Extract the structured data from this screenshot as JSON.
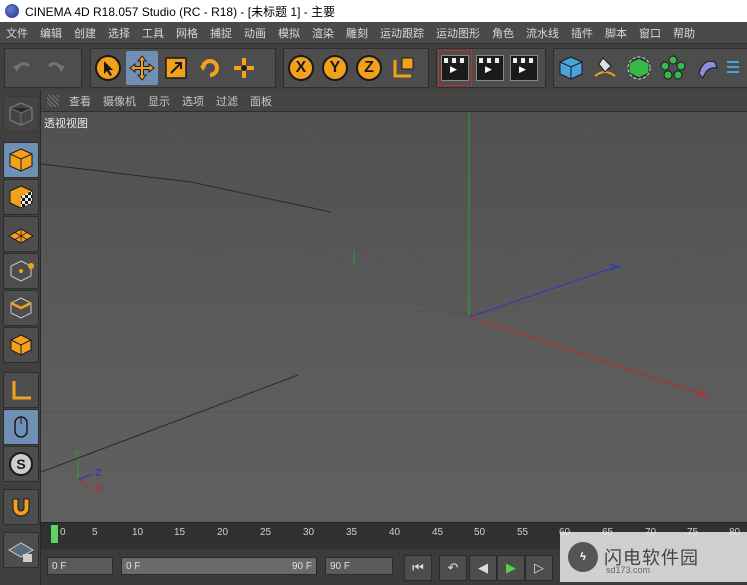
{
  "window": {
    "title": "CINEMA 4D R18.057 Studio (RC - R18) - [未标题 1] - 主要"
  },
  "menubar": {
    "items": [
      "文件",
      "编辑",
      "创建",
      "选择",
      "工具",
      "网格",
      "捕捉",
      "动画",
      "模拟",
      "渲染",
      "雕刻",
      "运动跟踪",
      "运动图形",
      "角色",
      "流水线",
      "插件",
      "脚本",
      "窗口",
      "帮助"
    ]
  },
  "toolbar": {
    "undo_icon": "undo-icon",
    "redo_icon": "redo-icon",
    "axis_x": "X",
    "axis_y": "Y",
    "axis_z": "Z"
  },
  "viewport_menu": {
    "items": [
      "查看",
      "摄像机",
      "显示",
      "选项",
      "过滤",
      "面板"
    ]
  },
  "viewport": {
    "label": "透视视图"
  },
  "axis_indicator": {
    "y": "Y",
    "z": "Z",
    "x": "X"
  },
  "timeline": {
    "ticks": [
      "0",
      "5",
      "10",
      "15",
      "20",
      "25",
      "30",
      "35",
      "40",
      "45",
      "50",
      "55",
      "60",
      "65",
      "70",
      "75",
      "80"
    ]
  },
  "bottom": {
    "current_frame": "0 F",
    "range_start": "0 F",
    "range_end": "90 F",
    "max_frame": "90 F"
  },
  "watermark": {
    "text": "闪电软件园",
    "sub": "sd173.com"
  },
  "colors": {
    "accent_orange": "#f3a11d",
    "active_blue": "#6f8fb5",
    "axis_green": "#2aa02a",
    "axis_red": "#c0282b",
    "axis_blue": "#2b39b8"
  }
}
